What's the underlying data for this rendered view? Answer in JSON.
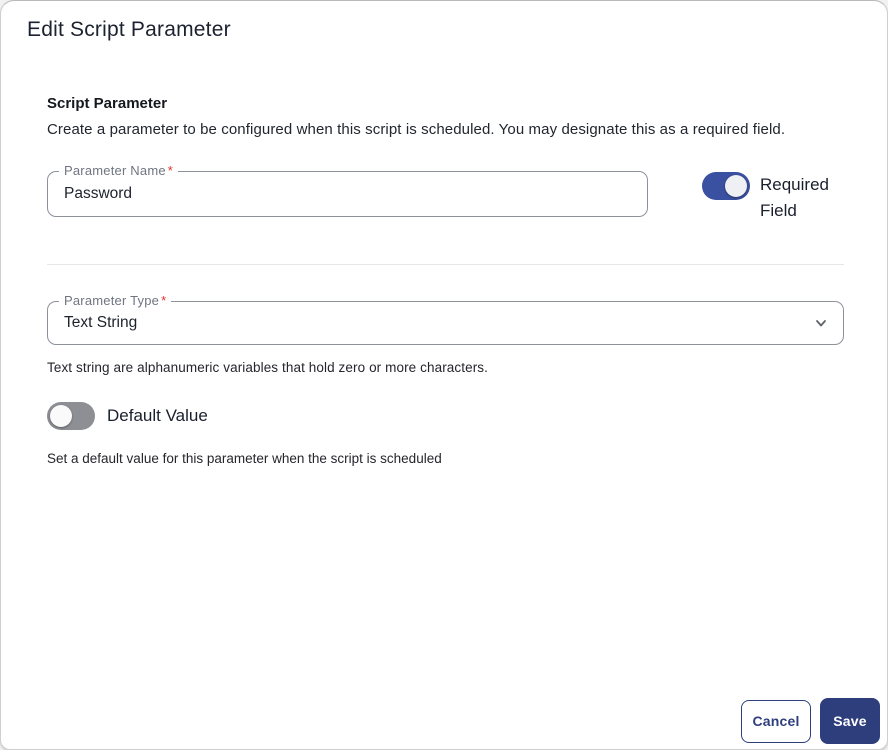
{
  "dialog": {
    "title": "Edit Script Parameter",
    "section": {
      "heading": "Script Parameter",
      "description": "Create a parameter to be configured when this script is scheduled. You may designate this as a required field."
    },
    "parameter_name": {
      "label": "Parameter Name",
      "required_marker": "*",
      "value": "Password"
    },
    "required_field_toggle": {
      "label": "Required Field",
      "state": "on"
    },
    "parameter_type": {
      "label": "Parameter Type",
      "required_marker": "*",
      "value": "Text String",
      "helper": "Text string are alphanumeric variables that hold zero or more characters."
    },
    "default_value_toggle": {
      "label": "Default Value",
      "state": "off",
      "helper": "Set a default value for this parameter when the script is scheduled"
    },
    "footer": {
      "cancel_label": "Cancel",
      "save_label": "Save"
    },
    "colors": {
      "accent_toggle_on": "#3a50a0",
      "save_button_bg": "#2e3e7d",
      "cancel_button_border": "#2f3f7e",
      "toggle_off_track": "#8d8f94",
      "required_asterisk": "#e0302e",
      "field_border": "#8d929b"
    }
  }
}
